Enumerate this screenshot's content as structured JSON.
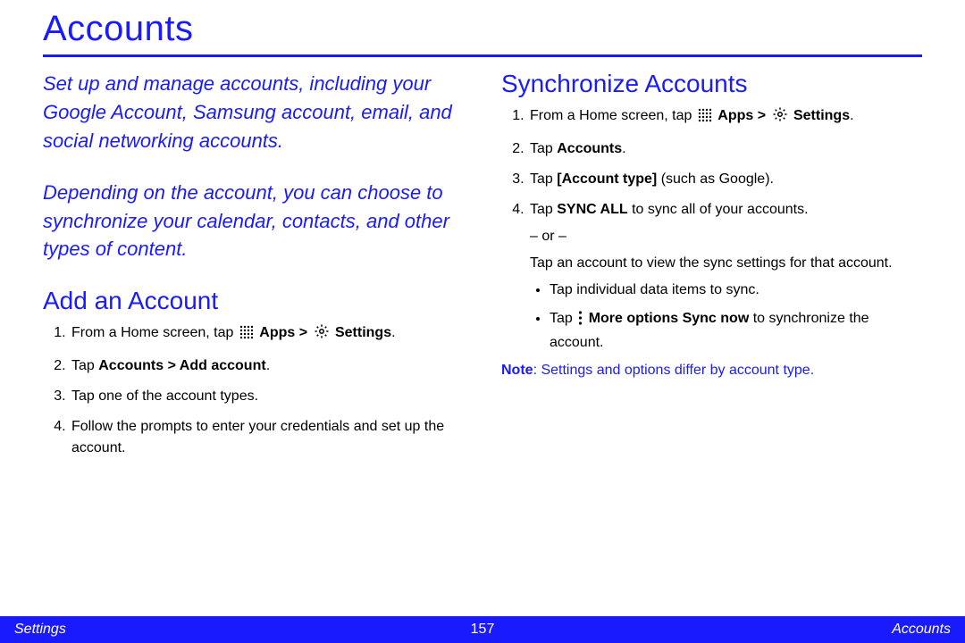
{
  "title": "Accounts",
  "intro": {
    "p1": "Set up and manage accounts, including your Google Account, Samsung account, email, and social networking accounts.",
    "p2": "Depending on the account, you can choose to synchronize your calendar, contacts, and other types of content."
  },
  "add": {
    "heading": "Add an Account",
    "s1_a": "From a Home screen, tap ",
    "s1_apps": "Apps > ",
    "s1_settings": "Settings",
    "s1_end": ".",
    "s2_a": "Tap ",
    "s2_b": "Accounts > Add account",
    "s2_c": ".",
    "s3": "Tap one of the account types.",
    "s4": "Follow the prompts to enter your credentials and set up the account."
  },
  "sync": {
    "heading": "Synchronize Accounts",
    "s1_a": "From a Home screen, tap ",
    "s1_apps": "Apps > ",
    "s1_settings": "Settings",
    "s1_end": ".",
    "s2_a": "Tap ",
    "s2_b": "Accounts",
    "s2_c": ".",
    "s3_a": "Tap ",
    "s3_b": "[Account type]",
    "s3_c": " (such as Google).",
    "s4_a": "Tap ",
    "s4_b": "SYNC ALL",
    "s4_c": " to sync all of your accounts.",
    "or": "– or –",
    "s4_d": "Tap an account to view the sync settings for that account.",
    "b1": "Tap individual data items to sync.",
    "b2_a": "Tap ",
    "b2_b": "More options Sync now",
    "b2_c": " to synchronize the account.",
    "note_label": "Note",
    "note_text": ": Settings and options differ by account type."
  },
  "footer": {
    "left": "Settings",
    "page": "157",
    "right": "Accounts"
  }
}
